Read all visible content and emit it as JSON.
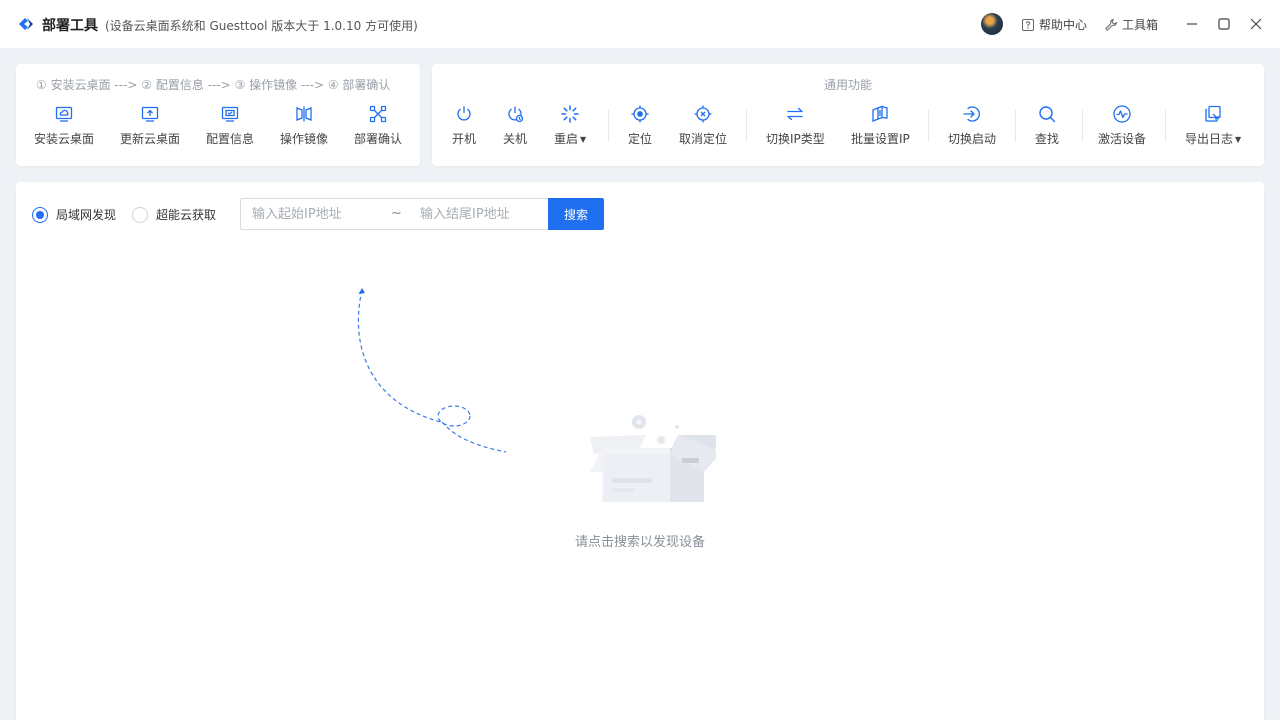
{
  "app": {
    "title": "部署工具",
    "subtitle": "(设备云桌面系统和 Guesttool 版本大于 1.0.10 方可使用)",
    "help_label": "帮助中心",
    "toolbox_label": "工具箱",
    "accent_color": "#1f6ff0"
  },
  "deploy_panel": {
    "steps": [
      "① 安装云桌面",
      "② 配置信息",
      "③ 操作镜像",
      "④ 部署确认"
    ],
    "step_arrow": "--->",
    "tools": [
      {
        "label": "安装云桌面",
        "icon": "install-desktop-icon"
      },
      {
        "label": "更新云桌面",
        "icon": "update-desktop-icon"
      },
      {
        "label": "配置信息",
        "icon": "config-info-icon"
      },
      {
        "label": "操作镜像",
        "icon": "mirror-icon"
      },
      {
        "label": "部署确认",
        "icon": "deploy-confirm-icon"
      }
    ]
  },
  "common_panel": {
    "caption": "通用功能",
    "tools": [
      {
        "label": "开机",
        "icon": "power-on-icon"
      },
      {
        "label": "关机",
        "icon": "power-off-icon"
      },
      {
        "label": "重启",
        "icon": "restart-icon",
        "dropdown": true
      },
      {
        "label": "定位",
        "icon": "locate-icon"
      },
      {
        "label": "取消定位",
        "icon": "cancel-locate-icon"
      },
      {
        "label": "切换IP类型",
        "icon": "switch-ip-type-icon"
      },
      {
        "label": "批量设置IP",
        "icon": "batch-ip-icon"
      },
      {
        "label": "切换启动",
        "icon": "switch-boot-icon"
      },
      {
        "label": "查找",
        "icon": "find-icon"
      },
      {
        "label": "激活设备",
        "icon": "activate-device-icon"
      },
      {
        "label": "导出日志",
        "icon": "export-log-icon",
        "dropdown": true
      }
    ]
  },
  "search": {
    "modes": [
      {
        "label": "局域网发现",
        "selected": true
      },
      {
        "label": "超能云获取",
        "selected": false
      }
    ],
    "start_placeholder": "输入起始IP地址",
    "end_placeholder": "输入结尾IP地址",
    "separator": "~",
    "button_label": "搜索"
  },
  "empty_state": {
    "message": "请点击搜索以发现设备"
  }
}
